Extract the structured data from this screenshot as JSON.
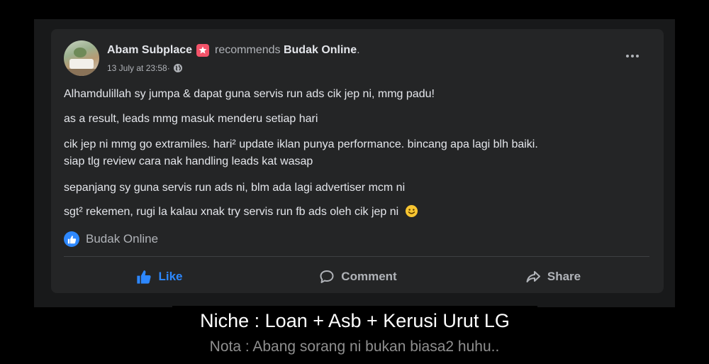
{
  "post": {
    "author": "Abam Subplace",
    "action_text": "recommends",
    "page": "Budak Online",
    "period": ".",
    "timestamp": "13 July at 23:58",
    "separator": " · ",
    "lines": [
      "Alhamdulillah sy jumpa & dapat guna servis run ads cik jep ni, mmg padu!",
      "as a result, leads mmg masuk menderu setiap hari",
      "cik jep ni mmg go extramiles. hari² update iklan punya performance. bincang apa lagi blh baiki.",
      "siap tlg review cara nak handling leads kat wasap",
      "sepanjang sy guna servis run ads ni, blm ada lagi advertiser mcm ni",
      "sgt² rekemen, rugi la kalau xnak try servis run fb ads oleh cik jep ni"
    ],
    "recommended_page": "Budak Online"
  },
  "actions": {
    "like": "Like",
    "comment": "Comment",
    "share": "Share"
  },
  "captions": {
    "niche": "Niche : Loan + Asb + Kerusi Urut LG",
    "note": "Nota : Abang sorang ni bukan biasa2 huhu.."
  },
  "icons": {
    "badge": "recommendation-badge-icon",
    "privacy": "globe-icon",
    "more": "more-options-icon",
    "emoji": "smile-emoji-icon",
    "like": "thumbs-up-icon",
    "comment": "comment-bubble-icon",
    "share": "share-arrow-icon"
  },
  "colors": {
    "card_bg": "#242526",
    "text_primary": "#e4e6eb",
    "text_secondary": "#b0b3b8",
    "accent_blue": "#2d88ff",
    "badge_red": "#f35369"
  }
}
